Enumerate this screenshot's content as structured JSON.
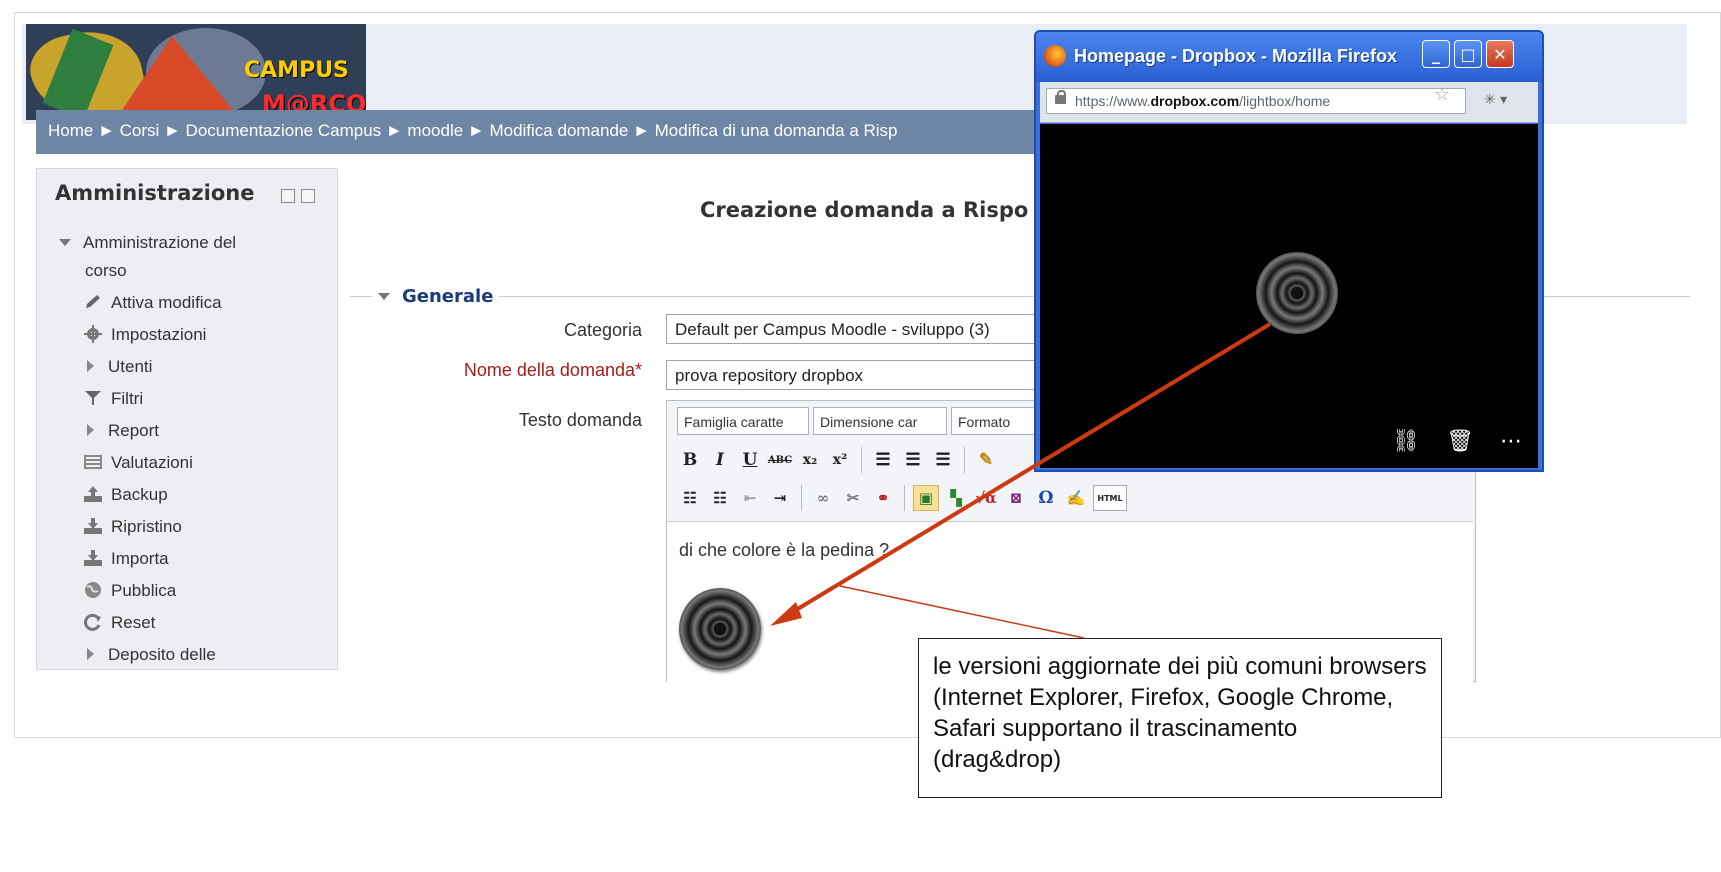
{
  "logo": {
    "line1": "CAMPUS",
    "line2": "M@RCONI"
  },
  "breadcrumb": {
    "text": "Home ► Corsi ► Documentazione Campus ► moodle ► Modifica domande ► Modifica di una domanda a Risp"
  },
  "admin_block": {
    "title": "Amministrazione",
    "section": "Amministrazione del",
    "section_cont": "corso",
    "items": [
      {
        "label": "Attiva modifica",
        "icon": "pencil-icon"
      },
      {
        "label": "Impostazioni",
        "icon": "gear-icon"
      },
      {
        "label": "Utenti",
        "icon": "triangle-right-icon"
      },
      {
        "label": "Filtri",
        "icon": "filter-icon"
      },
      {
        "label": "Report",
        "icon": "triangle-right-icon"
      },
      {
        "label": "Valutazioni",
        "icon": "grades-icon"
      },
      {
        "label": "Backup",
        "icon": "upload-icon"
      },
      {
        "label": "Ripristino",
        "icon": "download-icon"
      },
      {
        "label": "Importa",
        "icon": "download-icon"
      },
      {
        "label": "Pubblica",
        "icon": "globe-icon"
      },
      {
        "label": "Reset",
        "icon": "reset-icon"
      },
      {
        "label": "Deposito delle",
        "icon": "triangle-right-icon"
      }
    ]
  },
  "form": {
    "title": "Creazione domanda a Rispo",
    "legend": "Generale",
    "category_label": "Categoria",
    "category_value": "Default per Campus Moodle - sviluppo (3)",
    "name_label": "Nome della domanda*",
    "name_value": "prova repository dropbox",
    "text_label": "Testo domanda"
  },
  "editor": {
    "font_family": "Famiglia caratte",
    "font_size": "Dimensione car",
    "format": "Formato",
    "body_text": "di che colore è la pedina ?",
    "html_label": "HTML"
  },
  "firefox": {
    "title": "Homepage - Dropbox - Mozilla Firefox",
    "url_prefix": "https://www.",
    "url_domain": "dropbox.com",
    "url_path": "/lightbox/home"
  },
  "callout": {
    "text": "le versioni aggiornate dei più comuni browsers (Internet Explorer, Firefox, Google Chrome, Safari supportano il trascinamento (drag&drop)"
  },
  "colors": {
    "navbar": "#6d86a5",
    "arrow": "#cc3a12",
    "firefox_frame": "#2a5fd1"
  }
}
